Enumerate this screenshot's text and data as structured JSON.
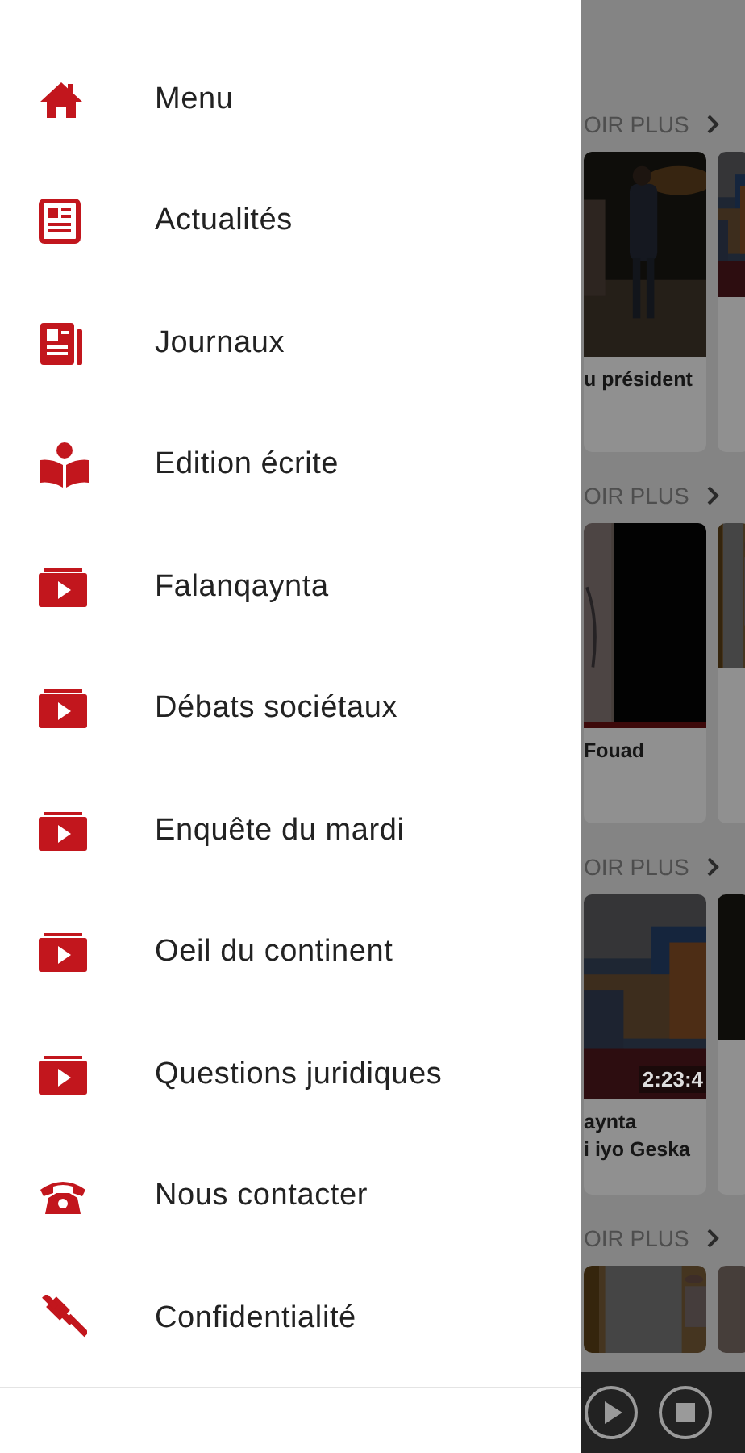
{
  "drawer": {
    "items": [
      {
        "label": "Menu",
        "kind": "home"
      },
      {
        "label": "Actualités",
        "kind": "article"
      },
      {
        "label": "Journaux",
        "kind": "newspaper"
      },
      {
        "label": "Edition écrite",
        "kind": "reader"
      },
      {
        "label": "Falanqaynta",
        "kind": "video"
      },
      {
        "label": "Débats sociétaux",
        "kind": "video"
      },
      {
        "label": "Enquête du mardi",
        "kind": "video"
      },
      {
        "label": "Oeil du continent",
        "kind": "video"
      },
      {
        "label": "Questions juridiques",
        "kind": "video"
      },
      {
        "label": "Nous contacter",
        "kind": "phone"
      },
      {
        "label": "Confidentialité",
        "kind": "gavel"
      }
    ]
  },
  "background": {
    "sections": [
      {
        "more": "OIR PLUS",
        "card": {
          "lines": [
            "u président"
          ]
        }
      },
      {
        "more": "OIR PLUS",
        "card": {
          "lines": [
            "Fouad"
          ]
        }
      },
      {
        "more": "OIR PLUS",
        "card": {
          "lines": [
            "aynta",
            "i iyo Geska"
          ],
          "duration": "2:23:4"
        }
      },
      {
        "more": "OIR PLUS"
      }
    ]
  }
}
